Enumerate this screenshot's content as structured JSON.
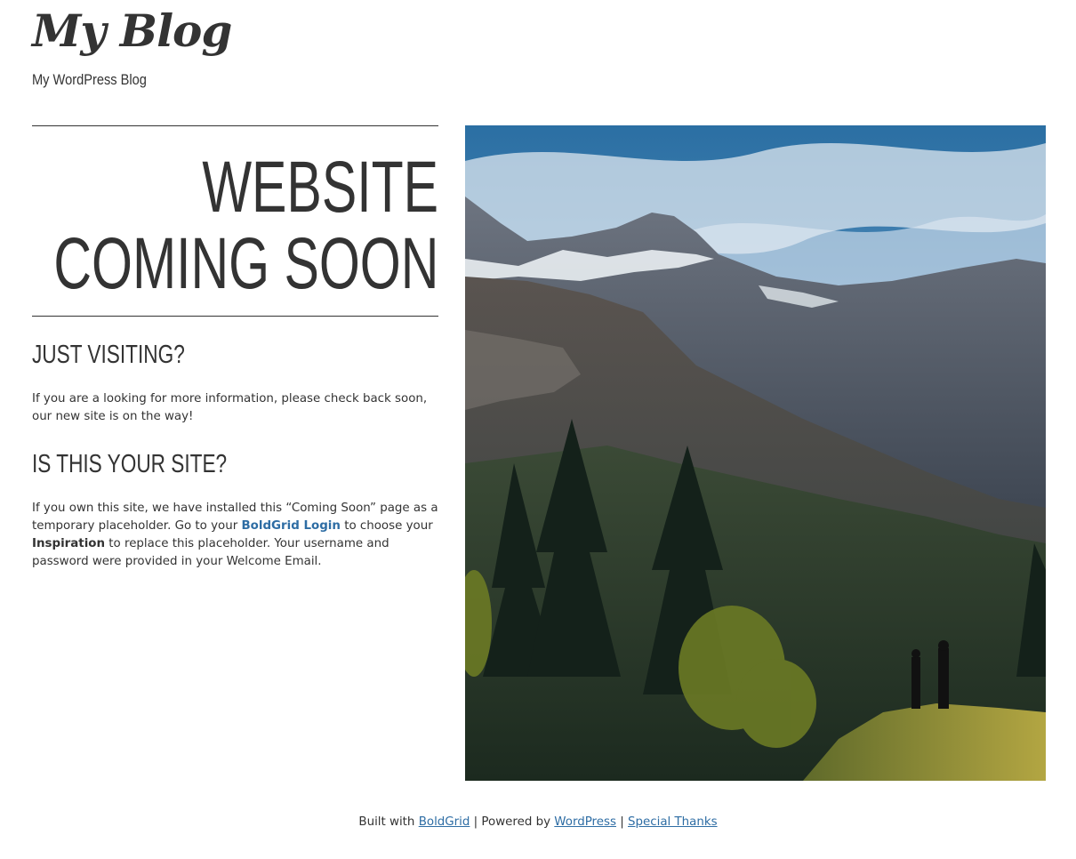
{
  "header": {
    "site_title": "My Blog",
    "tagline": "My WordPress Blog"
  },
  "hero": {
    "line1": "WEBSITE",
    "line2": "COMING SOON"
  },
  "visiting": {
    "title": "JUST VISITING?",
    "text": "If you are a looking for more information, please check back soon, our new site is on the way!"
  },
  "owner": {
    "title": "IS THIS YOUR SITE?",
    "text_1": "If you own this site, we have installed this “Coming Soon” page as a temporary placeholder. Go to your ",
    "login_link": "BoldGrid Login",
    "text_2": " to choose your ",
    "inspiration": "Inspiration",
    "text_3": " to replace this placeholder. Your username and password were provided in your Welcome Email."
  },
  "image": {
    "icon": "mountain-landscape-photo"
  },
  "footer": {
    "built_with": "Built with ",
    "boldgrid_link": "BoldGrid",
    "sep1": " | Powered by ",
    "wordpress_link": "WordPress",
    "sep2": " | ",
    "thanks_link": "Special Thanks"
  },
  "colors": {
    "text": "#333333",
    "link": "#2e6da4",
    "background": "#ffffff"
  }
}
